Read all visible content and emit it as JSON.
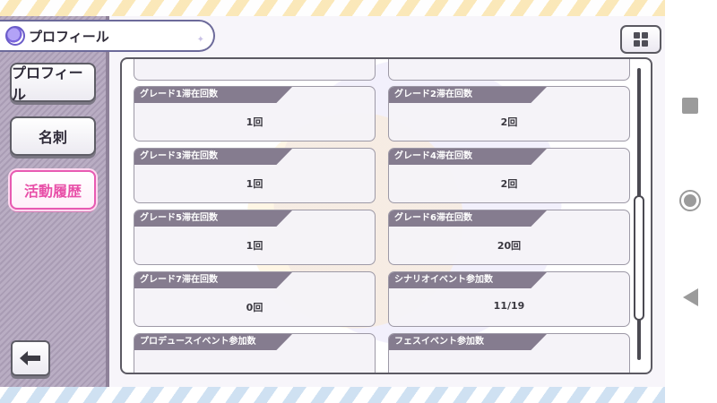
{
  "header": {
    "title": "プロフィール",
    "menu_icon": "grid-icon"
  },
  "sidebar": {
    "items": [
      {
        "label": "プロフィール",
        "active": false
      },
      {
        "label": "名刺",
        "active": false
      },
      {
        "label": "活動履歴",
        "active": true
      }
    ],
    "back_icon": "arrow-left-icon"
  },
  "stats": [
    {
      "label": "グレード1滞在回数",
      "value": "1回"
    },
    {
      "label": "グレード2滞在回数",
      "value": "2回"
    },
    {
      "label": "グレード3滞在回数",
      "value": "1回"
    },
    {
      "label": "グレード4滞在回数",
      "value": "2回"
    },
    {
      "label": "グレード5滞在回数",
      "value": "1回"
    },
    {
      "label": "グレード6滞在回数",
      "value": "20回"
    },
    {
      "label": "グレード7滞在回数",
      "value": "0回"
    },
    {
      "label": "シナリオイベント参加数",
      "value": "11/19"
    },
    {
      "label": "プロデュースイベント参加数",
      "value": ""
    },
    {
      "label": "フェスイベント参加数",
      "value": ""
    }
  ],
  "colors": {
    "accent_active": "#e84fa8",
    "card_label_bg": "#857c8f",
    "border": "#5c5a63"
  },
  "system_nav": {
    "icons": [
      "recents-square-icon",
      "home-circle-icon",
      "back-triangle-icon"
    ]
  }
}
